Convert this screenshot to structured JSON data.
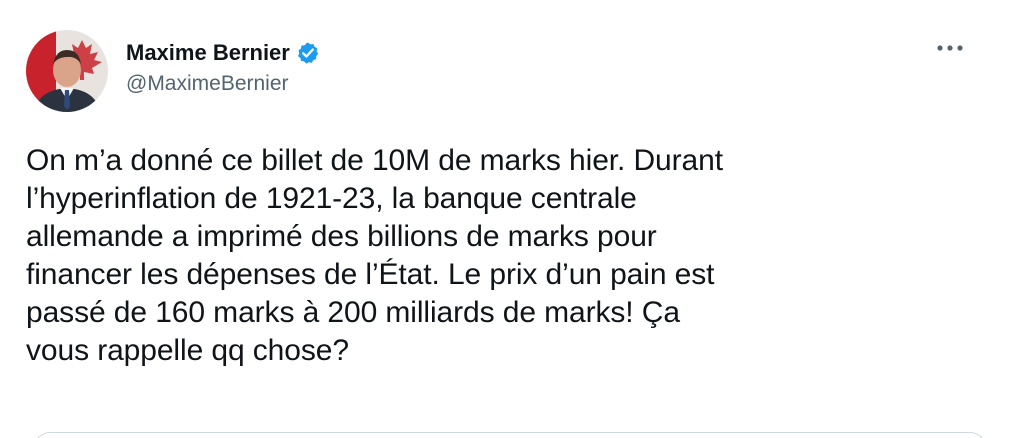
{
  "author": {
    "display_name": "Maxime Bernier",
    "handle": "@MaximeBernier",
    "verified": true,
    "avatar_icon": "profile-photo",
    "verified_icon": "verified-badge-icon",
    "verified_color": "#1d9bf0"
  },
  "menu": {
    "icon": "more-options-icon"
  },
  "tweet": {
    "text": "On m’a donné ce billet de 10M de marks hier. Durant\nl’hyperinflation de 1921-23, la banque centrale\nallemande a imprimé des billions de marks pour\nfinancer les dépenses de l’État. Le prix d’un pain est\npassé de 160 marks à 200 milliards de marks! Ça\nvous rappelle qq chose?"
  },
  "colors": {
    "text": "#0f1419",
    "secondary_text": "#536471",
    "accent": "#1d9bf0",
    "border": "#cfd9de"
  }
}
